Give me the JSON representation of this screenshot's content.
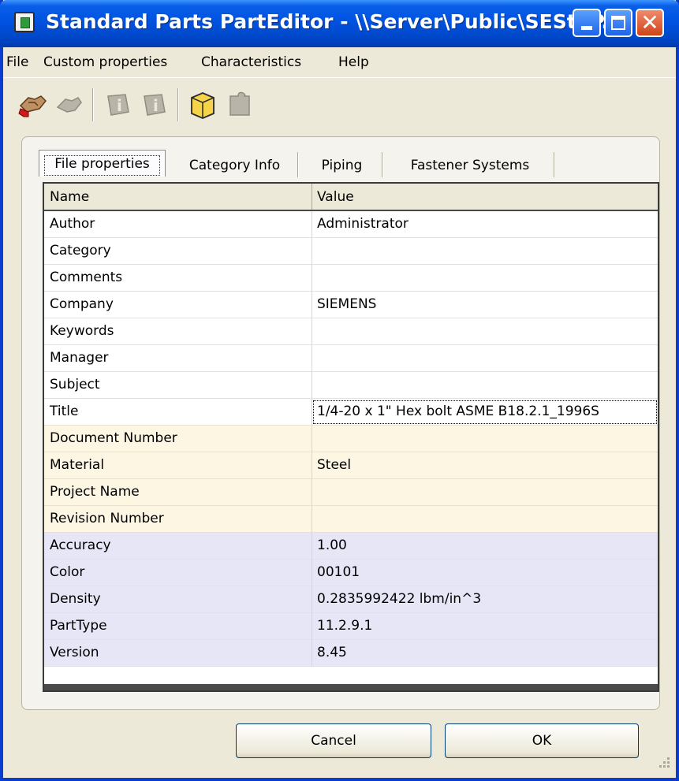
{
  "window": {
    "title": "Standard Parts PartEditor - \\\\Server\\Public\\SEStdP...",
    "title_color": "#ffffff",
    "titlebar_color": "#0054e3",
    "close_button_color": "#d04418"
  },
  "menu": {
    "items": [
      "File",
      "Custom properties",
      "Characteristics",
      "Help"
    ]
  },
  "toolbar": {
    "icons": [
      "handshake-icon",
      "handshake-disabled-icon",
      "info-disabled-icon",
      "info-disabled-icon",
      "open-folder-icon",
      "jigsaw-disabled-icon"
    ]
  },
  "tabs": [
    {
      "label": "File properties",
      "active": true
    },
    {
      "label": "Category Info",
      "active": false
    },
    {
      "label": "Piping",
      "active": false
    },
    {
      "label": "Fastener Systems",
      "active": false
    }
  ],
  "grid": {
    "headers": {
      "name": "Name",
      "value": "Value"
    },
    "colors": {
      "file": "#ffffff",
      "custom": "#fdf6e3",
      "characteristic": "#e6e6f7"
    },
    "rows": [
      {
        "name": "Author",
        "value": "Administrator",
        "group": "file"
      },
      {
        "name": "Category",
        "value": "",
        "group": "file"
      },
      {
        "name": "Comments",
        "value": "",
        "group": "file"
      },
      {
        "name": "Company",
        "value": "SIEMENS",
        "group": "file"
      },
      {
        "name": "Keywords",
        "value": "",
        "group": "file"
      },
      {
        "name": "Manager",
        "value": "",
        "group": "file"
      },
      {
        "name": "Subject",
        "value": "",
        "group": "file"
      },
      {
        "name": "Title",
        "value": "1/4-20 x 1\" Hex bolt ASME B18.2.1_1996S",
        "group": "file",
        "focused": true
      },
      {
        "name": "Document Number",
        "value": "",
        "group": "custom"
      },
      {
        "name": "Material",
        "value": "Steel",
        "group": "custom"
      },
      {
        "name": "Project Name",
        "value": "",
        "group": "custom"
      },
      {
        "name": "Revision Number",
        "value": "",
        "group": "custom"
      },
      {
        "name": "Accuracy",
        "value": "1.00",
        "group": "characteristic"
      },
      {
        "name": "Color",
        "value": "00101",
        "group": "characteristic"
      },
      {
        "name": "Density",
        "value": "0.2835992422 lbm/in^3",
        "group": "characteristic"
      },
      {
        "name": "PartType",
        "value": "11.2.9.1",
        "group": "characteristic"
      },
      {
        "name": "Version",
        "value": "8.45",
        "group": "characteristic"
      }
    ]
  },
  "buttons": {
    "cancel": "Cancel",
    "ok": "OK"
  }
}
